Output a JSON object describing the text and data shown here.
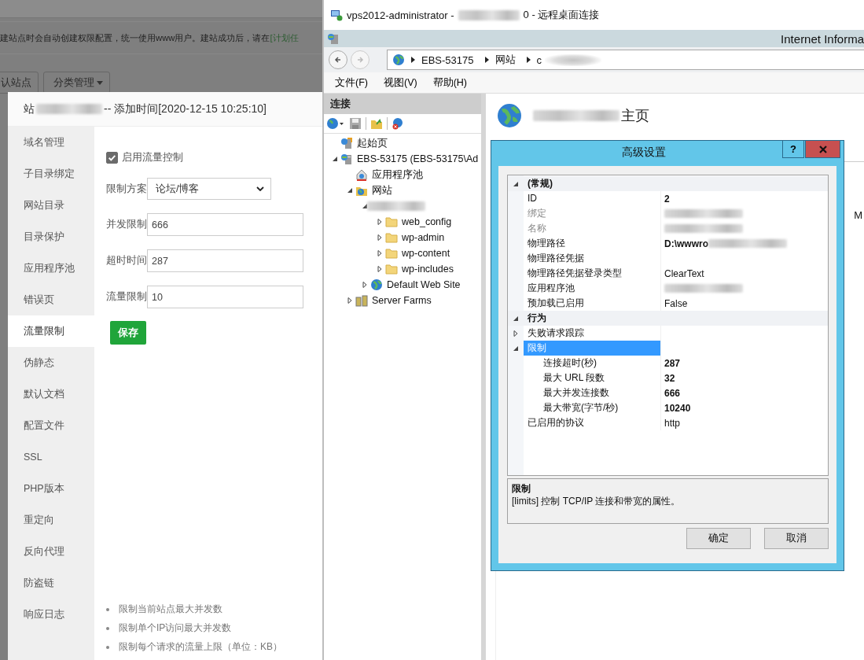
{
  "background_page": {
    "notice": "建站点时会自动创建权限配置，统一使用www用户。建站成功后，请在",
    "notice_link": "[计划任",
    "buttons": [
      {
        "label": "认站点",
        "caret": false
      },
      {
        "label": "分类管理",
        "caret": true
      }
    ]
  },
  "site_dialog": {
    "title_start": "站",
    "title_end": "-- 添加时间[2020-12-15 10:25:10]",
    "menu": [
      {
        "label": "域名管理",
        "selected": false
      },
      {
        "label": "子目录绑定",
        "selected": false
      },
      {
        "label": "网站目录",
        "selected": false
      },
      {
        "label": "目录保护",
        "selected": false
      },
      {
        "label": "应用程序池",
        "selected": false
      },
      {
        "label": "错误页",
        "selected": false
      },
      {
        "label": "流量限制",
        "selected": true
      },
      {
        "label": "伪静态",
        "selected": false
      },
      {
        "label": "默认文档",
        "selected": false
      },
      {
        "label": "配置文件",
        "selected": false
      },
      {
        "label": "SSL",
        "selected": false
      },
      {
        "label": "PHP版本",
        "selected": false
      },
      {
        "label": "重定向",
        "selected": false
      },
      {
        "label": "反向代理",
        "selected": false
      },
      {
        "label": "防盗链",
        "selected": false
      },
      {
        "label": "响应日志",
        "selected": false
      }
    ],
    "enable": {
      "label": "启用流量控制",
      "checked": true
    },
    "fields": [
      {
        "kind": "select",
        "label": "限制方案",
        "value": "论坛/博客"
      },
      {
        "kind": "input",
        "label": "并发限制",
        "value": "666"
      },
      {
        "kind": "input",
        "label": "超时时间",
        "value": "287"
      },
      {
        "kind": "input",
        "label": "流量限制",
        "value": "10"
      }
    ],
    "save": "保存",
    "notes": [
      "限制当前站点最大并发数",
      "限制单个IP访问最大并发数",
      "限制每个请求的流量上限（单位：KB）"
    ]
  },
  "remote_desktop": {
    "title_start": "vps2012-administrator -",
    "title_end": "0 - 远程桌面连接"
  },
  "iis": {
    "app_title": "Internet Informa",
    "breadcrumb": [
      {
        "label": "EBS-53175",
        "redacted": false
      },
      {
        "label": "网站",
        "redacted": false
      },
      {
        "label": "c",
        "redacted": true
      }
    ],
    "menu": [
      "文件(F)",
      "视图(V)",
      "帮助(H)"
    ],
    "connections_title": "连接",
    "tree": [
      {
        "kind": "home",
        "label": "起始页"
      },
      {
        "kind": "server",
        "label": "EBS-53175 (EBS-53175\\Ad",
        "expanded": true,
        "children": [
          {
            "kind": "pool",
            "label": "应用程序池"
          },
          {
            "kind": "sites",
            "label": "网站",
            "expanded": true,
            "children": [
              {
                "kind": "redacted",
                "expanded": true,
                "children": [
                  {
                    "kind": "folder",
                    "label": "web_config",
                    "expanded": false
                  },
                  {
                    "kind": "folder",
                    "label": "wp-admin",
                    "expanded": false
                  },
                  {
                    "kind": "folder",
                    "label": "wp-content",
                    "expanded": false
                  },
                  {
                    "kind": "folder",
                    "label": "wp-includes",
                    "expanded": false
                  }
                ]
              },
              {
                "kind": "site",
                "label": "Default Web Site",
                "expanded": false
              }
            ]
          },
          {
            "kind": "farm",
            "label": "Server Farms",
            "expanded": false
          }
        ]
      }
    ],
    "page_title": "主页",
    "side_text": "M"
  },
  "advanced_settings": {
    "title": "高级设置",
    "help": "?",
    "groups": [
      {
        "name": "(常规)",
        "expanded": true,
        "rows": [
          {
            "name": "ID",
            "value": "2",
            "bold": true,
            "disabled": false
          },
          {
            "name": "绑定",
            "redacted": true,
            "disabled": true
          },
          {
            "name": "名称",
            "redacted": true,
            "disabled": true
          },
          {
            "name": "物理路径",
            "value": "D:\\wwwro",
            "redacted": true,
            "bold": true,
            "disabled": false
          },
          {
            "name": "物理路径凭据",
            "disabled": false
          },
          {
            "name": "物理路径凭据登录类型",
            "value": "ClearText",
            "bold": false,
            "disabled": false
          },
          {
            "name": "应用程序池",
            "redacted": true,
            "disabled": false
          },
          {
            "name": "预加载已启用",
            "value": "False",
            "bold": false,
            "disabled": false
          }
        ]
      },
      {
        "name": "行为",
        "expanded": true,
        "rows": [
          {
            "name": "失败请求跟踪",
            "expanded": false,
            "disabled": false,
            "selected": false
          },
          {
            "name": "限制",
            "expanded": true,
            "disabled": false,
            "selected": true,
            "children": [
              {
                "name": "连接超时(秒)",
                "value": "287",
                "bold": true,
                "disabled": false
              },
              {
                "name": "最大 URL 段数",
                "value": "32",
                "bold": true,
                "disabled": false
              },
              {
                "name": "最大并发连接数",
                "value": "666",
                "bold": true,
                "disabled": false
              },
              {
                "name": "最大带宽(字节/秒)",
                "value": "10240",
                "bold": true,
                "disabled": false
              }
            ]
          },
          {
            "name": "已启用的协议",
            "value": "http",
            "bold": false,
            "disabled": false,
            "selected": false
          }
        ]
      }
    ],
    "description_title": "限制",
    "description": "[limits] 控制 TCP/IP 连接和带宽的属性。",
    "buttons": [
      "确定",
      "取消"
    ]
  }
}
